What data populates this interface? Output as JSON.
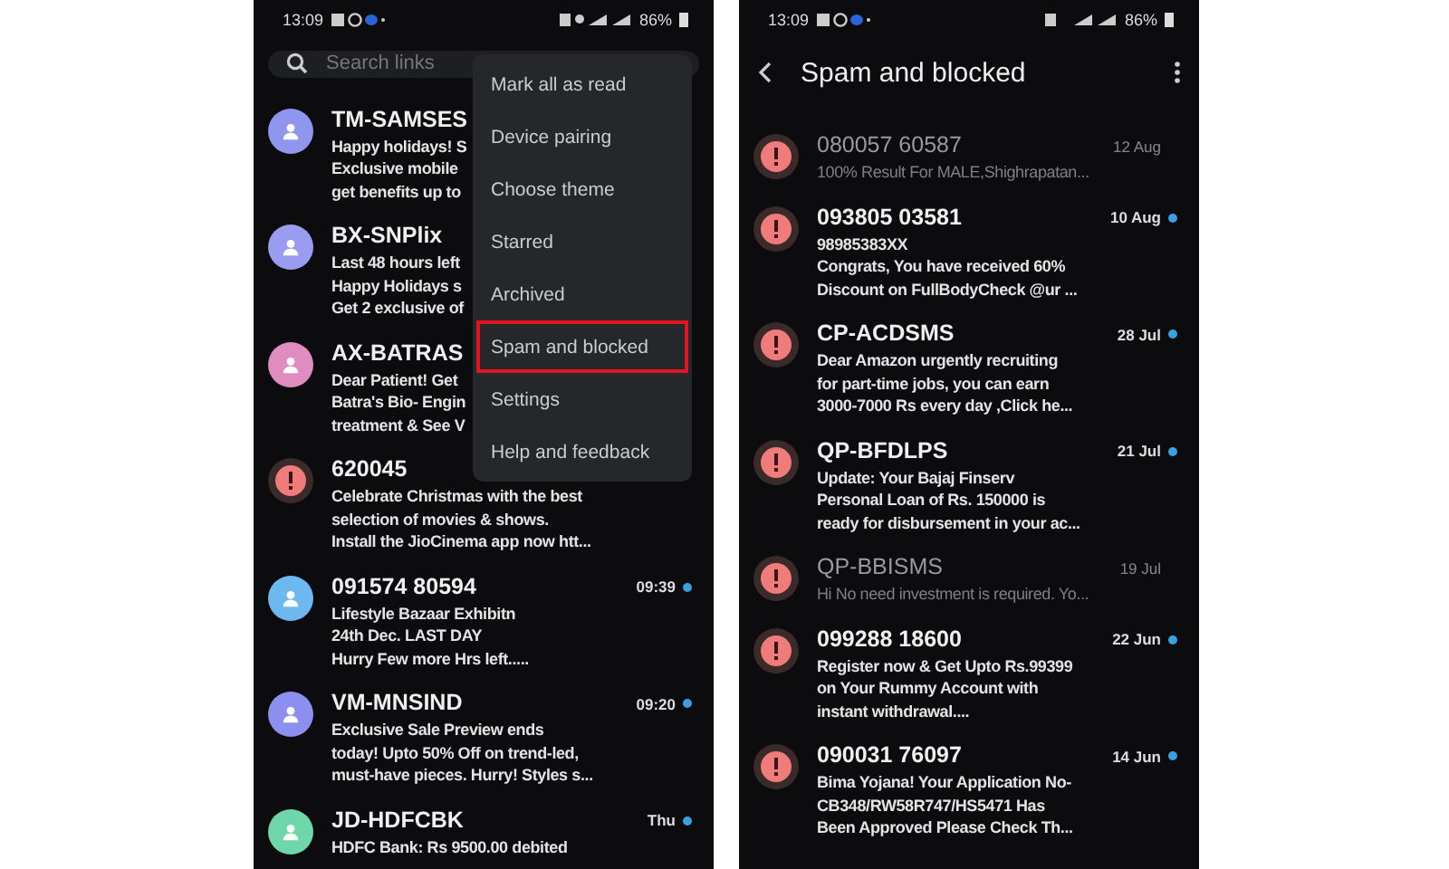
{
  "phones": [
    {
      "status_bar": {
        "time": "13:09",
        "battery": "86%"
      },
      "search": {
        "placeholder": "Search links"
      },
      "conversations": [
        {
          "name": "TM-SAMSES",
          "kind": "contact",
          "color": "#9096ee",
          "lines": [
            "Happy holidays! S",
            "Exclusive mobile",
            "get benefits up to"
          ],
          "unread": true
        },
        {
          "name": "BX-SNPlix",
          "kind": "contact",
          "color": "#9a9cf0",
          "lines": [
            "Last 48 hours left",
            "Happy Holidays s",
            "Get 2 exclusive of"
          ],
          "unread": true
        },
        {
          "name": "AX-BATRAS",
          "kind": "contact",
          "color": "#e08cc0",
          "lines": [
            "Dear Patient! Get",
            "Batra's Bio- Engin",
            "treatment & See V"
          ],
          "unread": true
        },
        {
          "name": "620045",
          "kind": "spam",
          "lines": [
            "Celebrate Christmas with the best",
            "selection of movies & shows.",
            "Install the JioCinema app now htt..."
          ],
          "unread": true
        },
        {
          "name": "091574 80594",
          "kind": "contact",
          "color": "#6db8ef",
          "lines": [
            "Lifestyle Bazaar Exhibitn",
            "24th Dec. LAST DAY",
            "Hurry Few more Hrs left....."
          ],
          "time": "09:39",
          "unread": true
        },
        {
          "name": "VM-MNSIND",
          "kind": "contact",
          "color": "#8c8ff0",
          "lines": [
            "Exclusive Sale Preview ends",
            "today! Upto 50% Off on trend-led,",
            "must-have pieces. Hurry! Styles s..."
          ],
          "time": "09:20",
          "unread": true
        },
        {
          "name": "JD-HDFCBK",
          "kind": "contact",
          "color": "#6ed6ab",
          "lines": [
            "HDFC Bank: Rs 9500.00 debited"
          ],
          "time": "Thu",
          "unread": true
        }
      ],
      "menu": [
        {
          "label": "Mark all as read",
          "selected": false
        },
        {
          "label": "Device pairing",
          "selected": false
        },
        {
          "label": "Choose theme",
          "selected": false
        },
        {
          "label": "Starred",
          "selected": false
        },
        {
          "label": "Archived",
          "selected": false
        },
        {
          "label": "Spam and blocked",
          "selected": true
        },
        {
          "label": "Settings",
          "selected": false
        },
        {
          "label": "Help and feedback",
          "selected": false
        }
      ]
    },
    {
      "status_bar": {
        "time": "13:09",
        "battery": "86%"
      },
      "title": "Spam and blocked",
      "conversations": [
        {
          "name": "080057 60587",
          "kind": "spam",
          "lines": [
            "100% Result For MALE,Shighrapatan..."
          ],
          "time": "12 Aug",
          "unread": false
        },
        {
          "name": "093805 03581",
          "kind": "spam",
          "lines": [
            "98985383XX",
            "Congrats, You have received 60%",
            "Discount on FullBodyCheck @ur ..."
          ],
          "time": "10 Aug",
          "unread": true
        },
        {
          "name": "CP-ACDSMS",
          "kind": "spam",
          "lines": [
            "Dear Amazon urgently recruiting",
            "for part-time jobs, you can earn",
            "3000-7000 Rs every day ,Click he..."
          ],
          "time": "28 Jul",
          "unread": true
        },
        {
          "name": "QP-BFDLPS",
          "kind": "spam",
          "lines": [
            "Update: Your Bajaj Finserv",
            "Personal Loan of Rs. 150000 is",
            "ready for disbursement in your ac..."
          ],
          "time": "21 Jul",
          "unread": true
        },
        {
          "name": "QP-BBISMS",
          "kind": "spam",
          "lines": [
            "Hi No need investment is required. Yo..."
          ],
          "time": "19 Jul",
          "unread": false
        },
        {
          "name": "099288 18600",
          "kind": "spam",
          "lines": [
            "Register now & Get Upto Rs.99399",
            "on Your Rummy Account with",
            "instant withdrawal...."
          ],
          "time": "22 Jun",
          "unread": true
        },
        {
          "name": "090031 76097",
          "kind": "spam",
          "lines": [
            "Bima Yojana! Your Application No-",
            "CB348/RW58R747/HS5471 Has",
            "Been Approved Please Check Th..."
          ],
          "time": "14 Jun",
          "unread": true
        }
      ]
    }
  ]
}
